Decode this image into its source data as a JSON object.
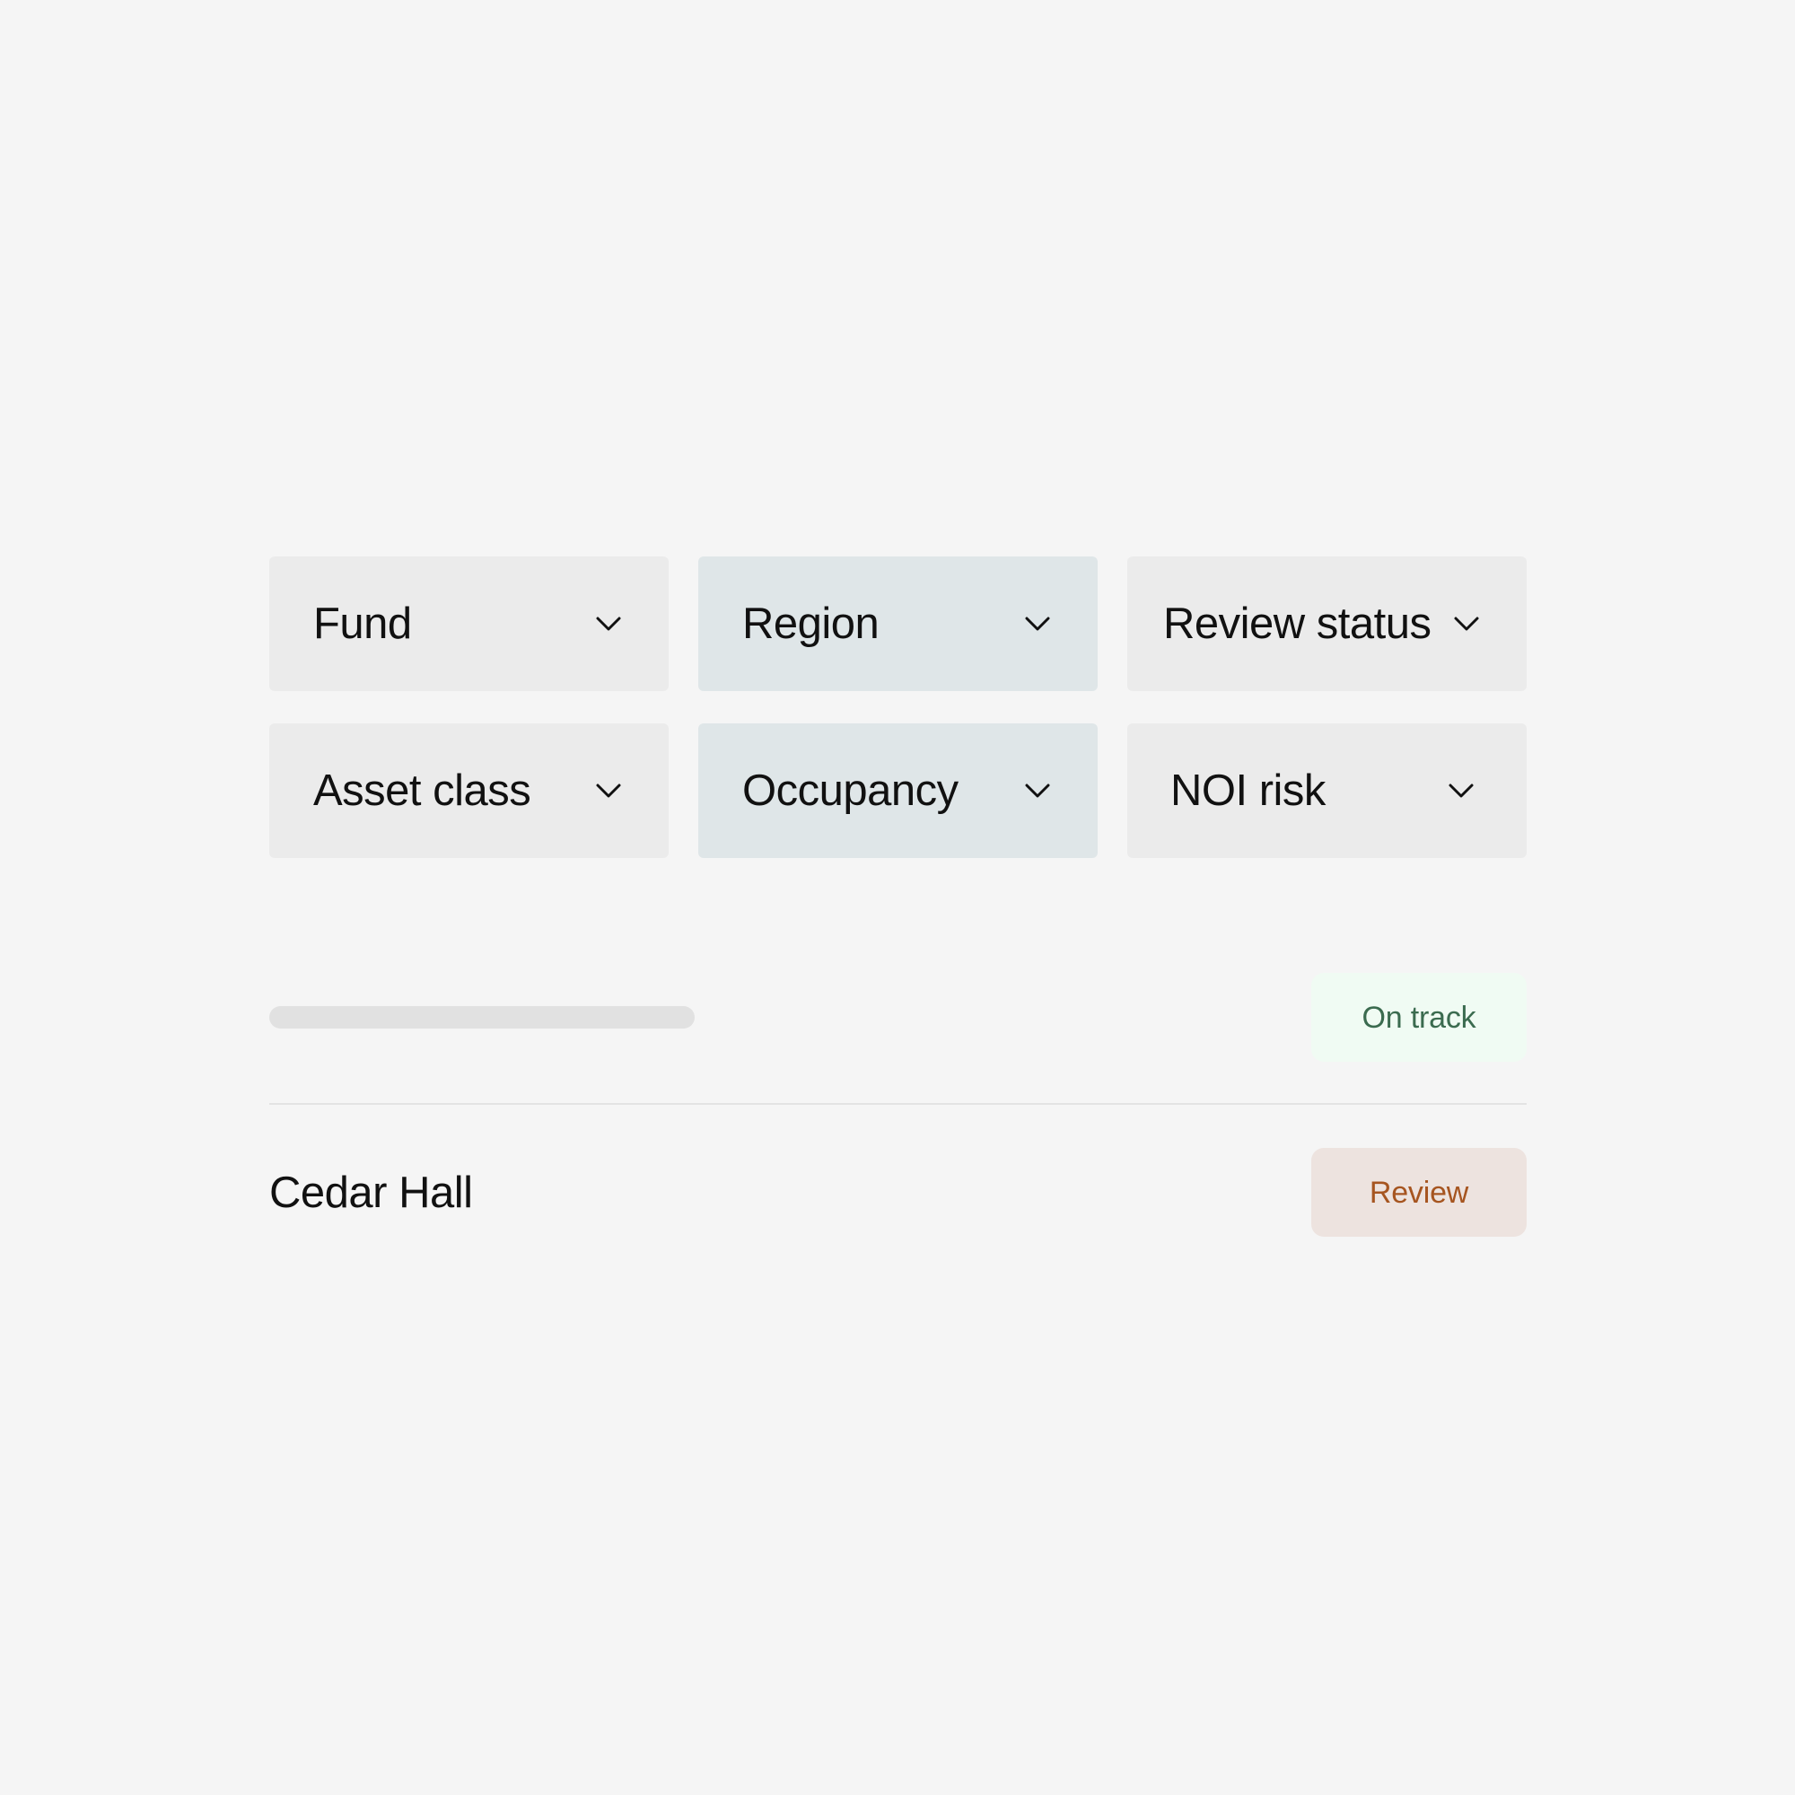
{
  "filters": {
    "fund": {
      "label": "Fund",
      "icon": "chevron-down-icon"
    },
    "region": {
      "label": "Region",
      "icon": "chevron-down-icon"
    },
    "review_status": {
      "label": "Review status",
      "icon": "chevron-down-icon"
    },
    "asset_class": {
      "label": "Asset class",
      "icon": "chevron-down-icon"
    },
    "occupancy": {
      "label": "Occupancy",
      "icon": "chevron-down-icon"
    },
    "noi_risk": {
      "label": "NOI risk",
      "icon": "chevron-down-icon"
    }
  },
  "progress": {
    "value_percent": 0
  },
  "status": {
    "label": "On track",
    "color": "#3b6b4f",
    "background": "#f0fbf3"
  },
  "property": {
    "name": "Cedar Hall"
  },
  "actions": {
    "review_label": "Review",
    "review_color": "#a65520",
    "review_background": "#ede3df"
  },
  "colors": {
    "page_background": "#f5f5f5",
    "filter_background": "#ebebeb",
    "filter_alt_background": "#dfe6e8",
    "divider": "#e3e3e3"
  }
}
